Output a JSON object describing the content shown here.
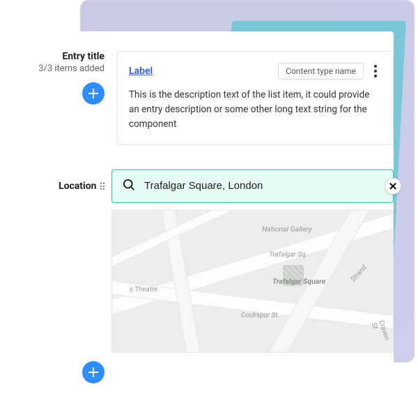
{
  "entry": {
    "title": "Entry title",
    "count_text": "3/3 items added",
    "card": {
      "label": "Label",
      "content_type": "Content type name",
      "description": "This is the description text of the list item, it could provide an entry description or some other long text string for the component"
    }
  },
  "location": {
    "label": "Location",
    "search_value": "Trafalgar Square, London",
    "map_labels": {
      "l1": "National Gallery",
      "l2": "Trafalgar Sq.",
      "l3": "Trafalgar Square",
      "l4": "Cockspur St.",
      "l5": "Strand",
      "l6": "Craven St",
      "l7": "s Theatre"
    }
  }
}
